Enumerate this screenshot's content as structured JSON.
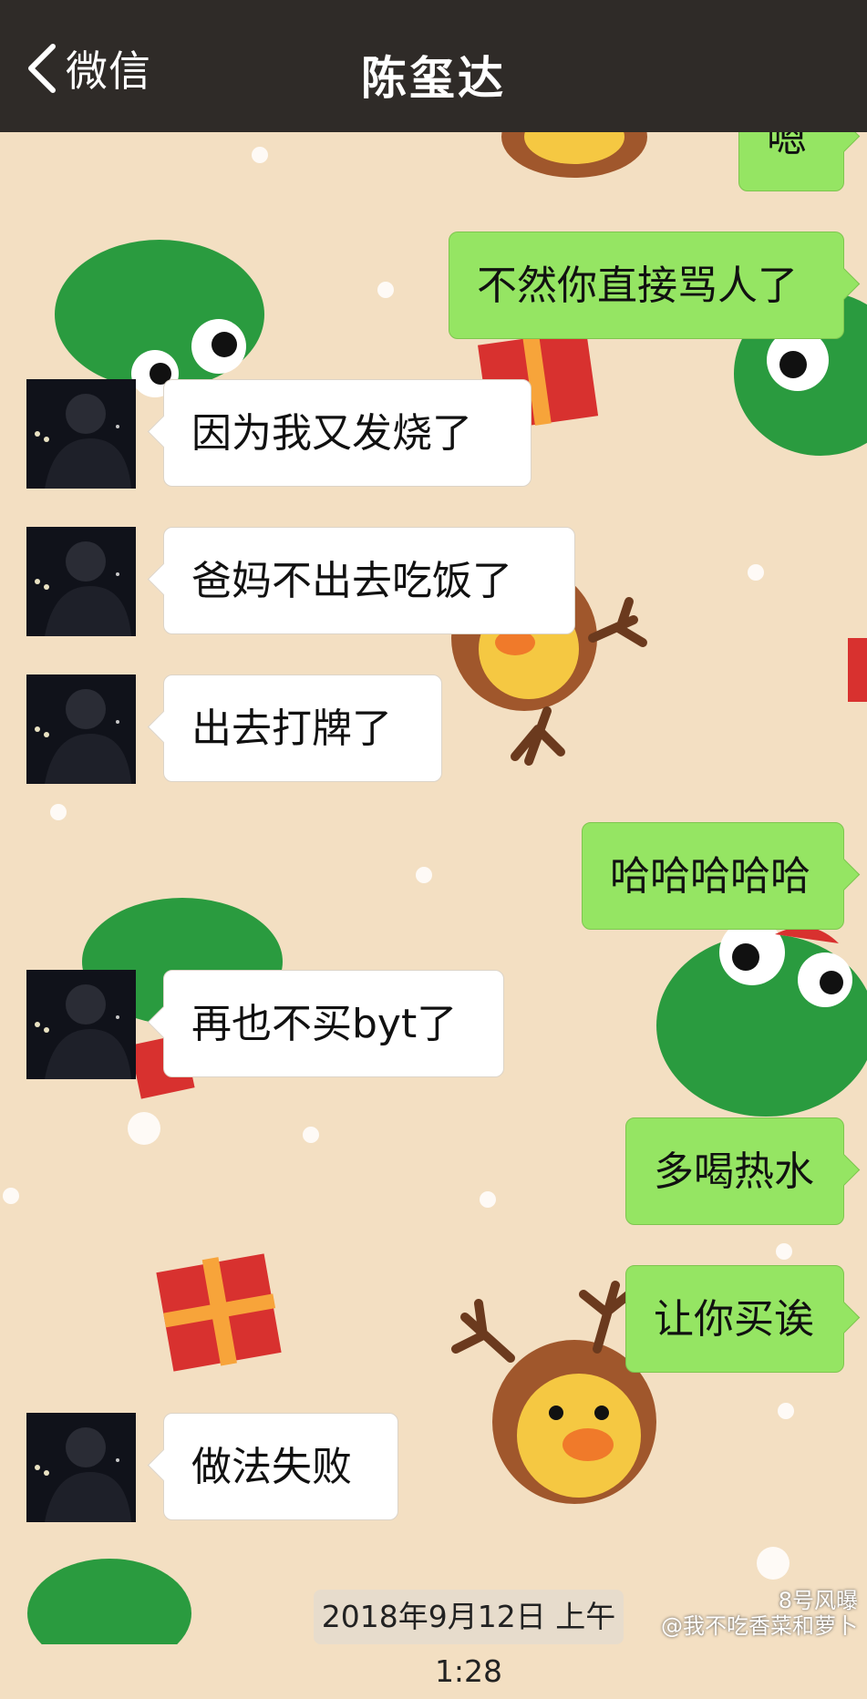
{
  "nav": {
    "back_label": "微信",
    "title": "陈玺达"
  },
  "messages": [
    {
      "side": "out",
      "text": "嗯"
    },
    {
      "side": "out",
      "text": "不然你直接骂人了"
    },
    {
      "side": "in",
      "text": "因为我又发烧了"
    },
    {
      "side": "in",
      "text": "爸妈不出去吃饭了"
    },
    {
      "side": "in",
      "text": "出去打牌了"
    },
    {
      "side": "out",
      "text": "哈哈哈哈哈"
    },
    {
      "side": "in",
      "text": "再也不买byt了"
    },
    {
      "side": "out",
      "text": "多喝热水"
    },
    {
      "side": "out",
      "text": "让你买诶"
    },
    {
      "side": "in",
      "text": "做法失败"
    }
  ],
  "timestamp": "2018年9月12日 上午1:28",
  "watermark": {
    "line1": "8号风曝",
    "line2": "@我不吃香菜和萝卜"
  },
  "colors": {
    "nav_background": "#2f2b28",
    "chat_background": "#f3dfc2",
    "outgoing_bubble": "#95e563",
    "incoming_bubble": "#ffffff"
  }
}
